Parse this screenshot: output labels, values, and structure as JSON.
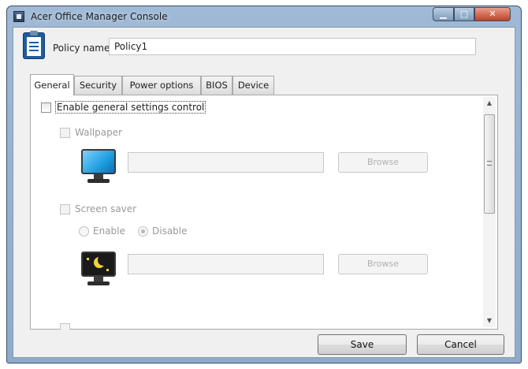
{
  "window": {
    "title": "Acer Office Manager Console",
    "close_glyph": "✕",
    "min_glyph": "▁",
    "max_glyph": "□"
  },
  "policy": {
    "label": "Policy name",
    "value": "Policy1",
    "icon": "policy-document-icon"
  },
  "tabs": [
    {
      "label": "General",
      "active": true
    },
    {
      "label": "Security",
      "active": false
    },
    {
      "label": "Power options",
      "active": false
    },
    {
      "label": "BIOS",
      "active": false
    },
    {
      "label": "Device",
      "active": false
    }
  ],
  "general": {
    "enable_label": "Enable general settings control",
    "wallpaper": {
      "label": "Wallpaper",
      "path_value": "",
      "browse_label": "Browse",
      "icon": "monitor-wallpaper-icon"
    },
    "screensaver": {
      "label": "Screen saver",
      "enable_label": "Enable",
      "disable_label": "Disable",
      "selected": "Disable",
      "path_value": "",
      "browse_label": "Browse",
      "icon": "monitor-screensaver-icon"
    }
  },
  "scroll": {
    "up_glyph": "▲",
    "down_glyph": "▼"
  },
  "footer": {
    "save_label": "Save",
    "cancel_label": "Cancel"
  },
  "colors": {
    "title_bar": "#9fb9d6",
    "close_button": "#c0402a",
    "wallpaper_screen": "#1e9fe3",
    "screensaver_screen": "#1a1a1a",
    "screensaver_moon": "#f2d23a"
  }
}
